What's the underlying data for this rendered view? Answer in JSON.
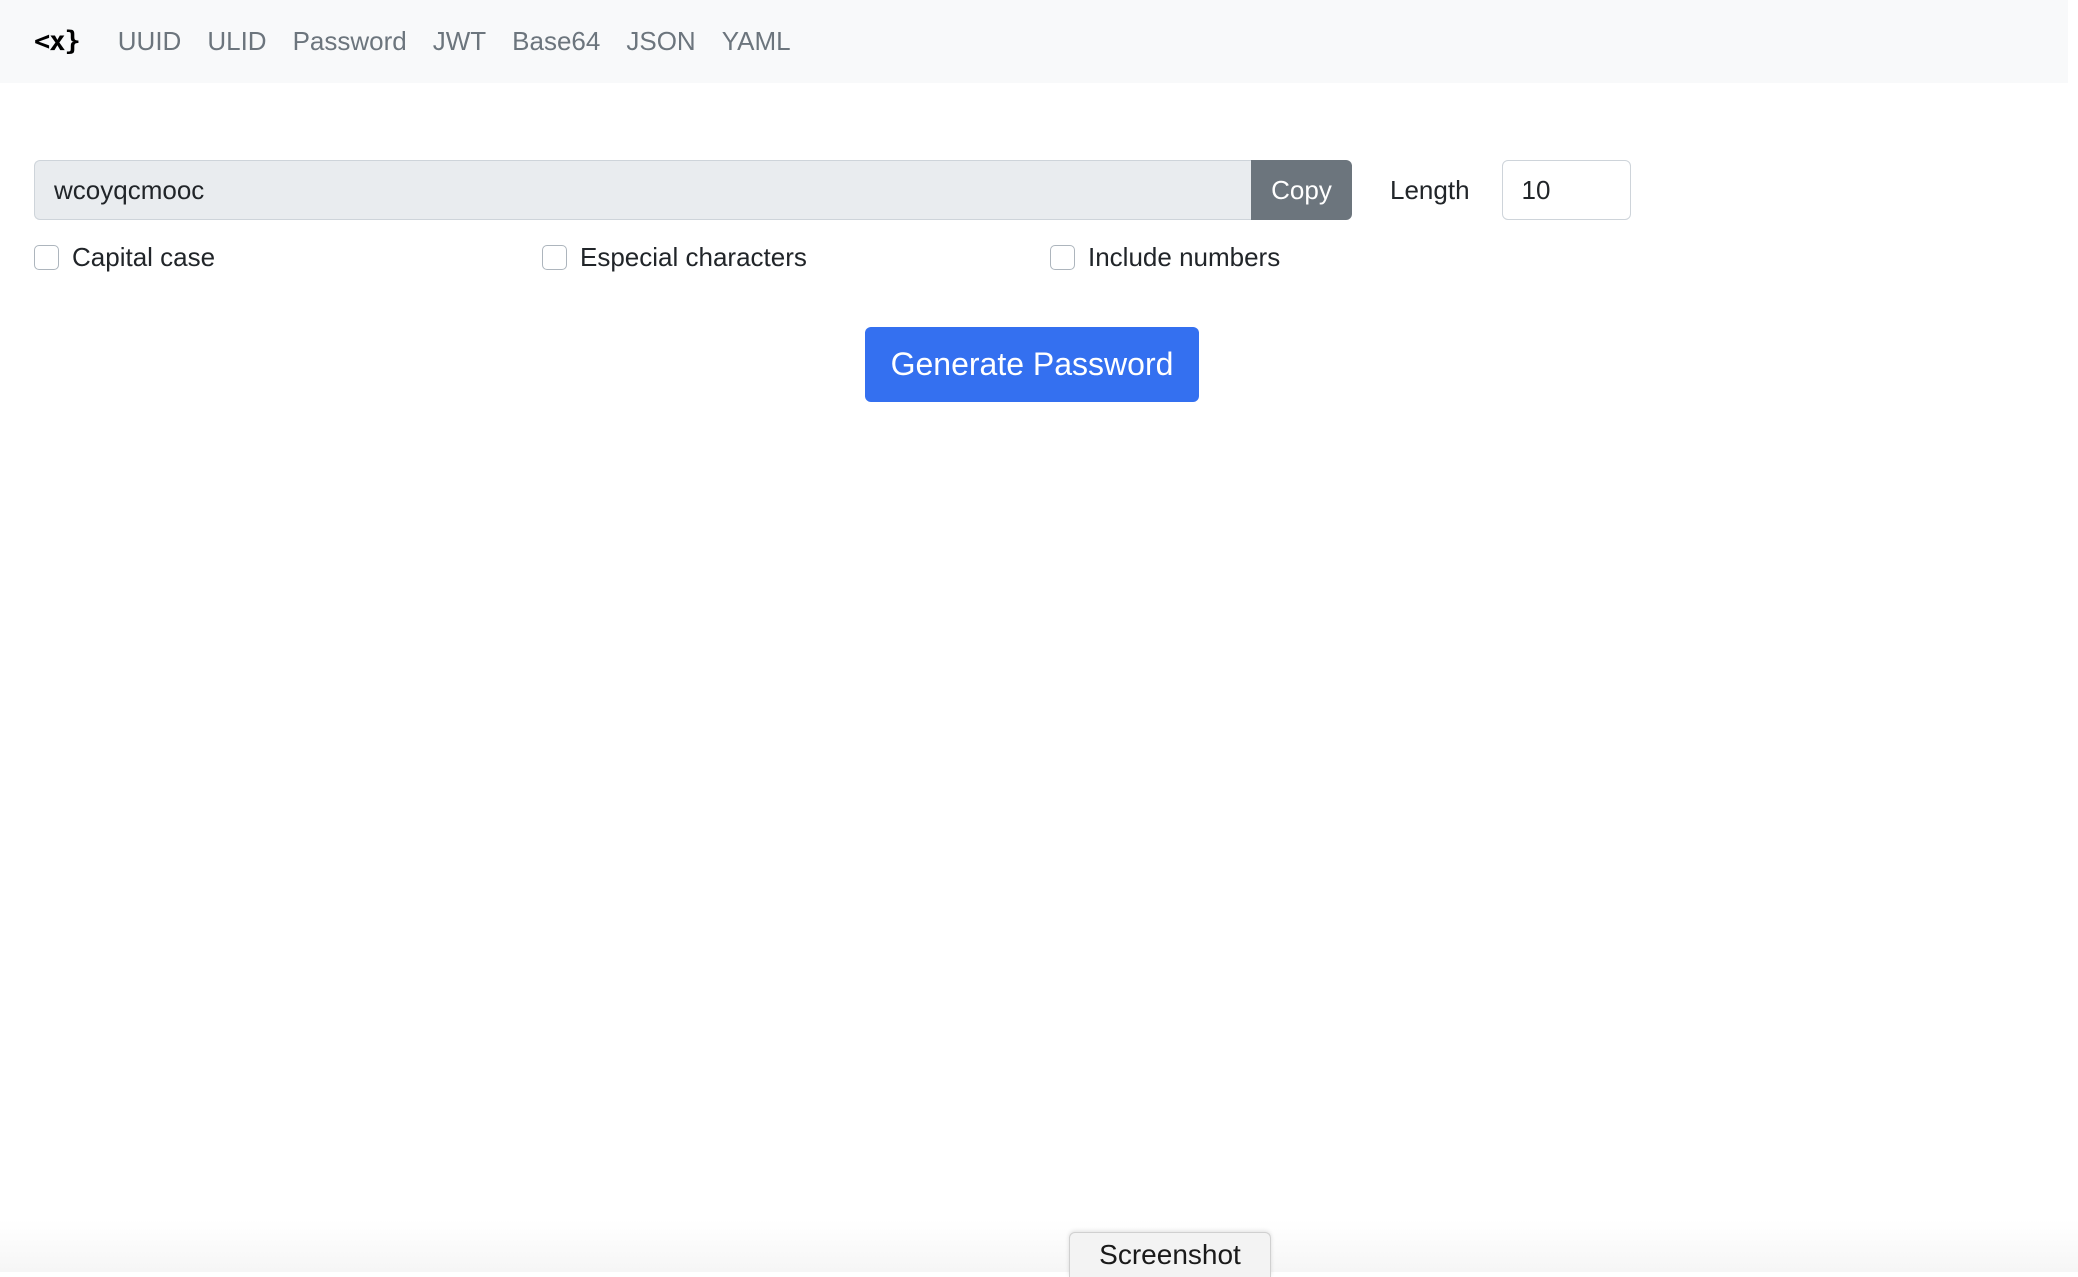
{
  "navbar": {
    "brand": "<x}",
    "links": [
      "UUID",
      "ULID",
      "Password",
      "JWT",
      "Base64",
      "JSON",
      "YAML"
    ]
  },
  "generator": {
    "password_value": "wcoyqcmooc",
    "copy_label": "Copy",
    "length_label": "Length",
    "length_value": "10",
    "options": [
      {
        "label": "Capital case",
        "checked": false
      },
      {
        "label": "Especial characters",
        "checked": false
      },
      {
        "label": "Include numbers",
        "checked": false
      }
    ],
    "generate_label": "Generate Password"
  },
  "overlay": {
    "screenshot_label": "Screenshot"
  },
  "colors": {
    "navbar_bg": "#f8f9fa",
    "primary": "#3470f0",
    "secondary": "#6c757d",
    "readonly_bg": "#e9ecef"
  }
}
